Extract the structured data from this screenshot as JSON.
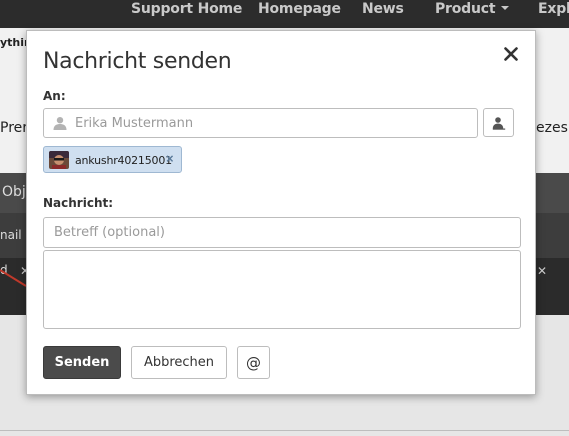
{
  "top_nav": {
    "items": [
      "Support Home",
      "Homepage",
      "News",
      "Product",
      "Explo"
    ]
  },
  "background": {
    "text_top_left": "ythin",
    "text_row_left": "Prera",
    "text_row_right": "ezes.",
    "text_band_dark": "Obj",
    "text_band_mid": "nail",
    "text_band_bottom": "d"
  },
  "dialog": {
    "title": "Nachricht senden",
    "to_label": "An:",
    "to_placeholder": "Erika Mustermann",
    "recipient_chip": "ankushr40215001",
    "message_label": "Nachricht:",
    "subject_placeholder": "Betreff (optional)",
    "send_label": "Senden",
    "cancel_label": "Abbrechen",
    "mention_label": "@"
  },
  "colors": {
    "nav_bg": "#2c2c2c",
    "primary_button": "#4b4b4b",
    "chip_bg": "#cfdff0"
  },
  "icons": [
    "close-icon",
    "person-icon",
    "address-book-icon",
    "chip-remove-icon"
  ]
}
